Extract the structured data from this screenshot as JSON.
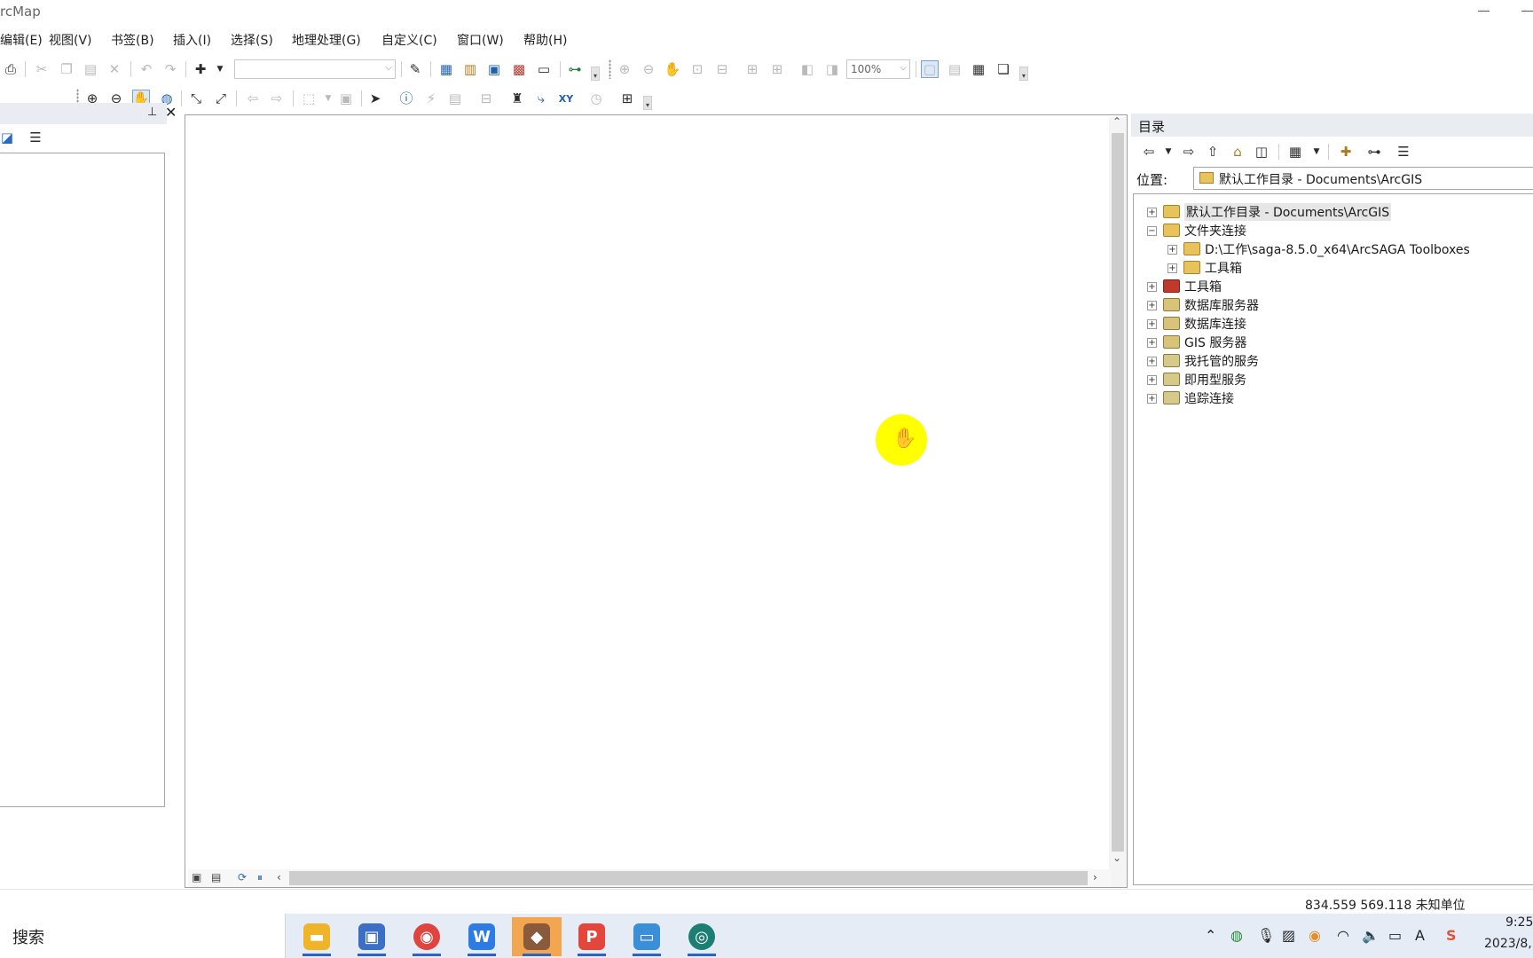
{
  "window": {
    "title": "rcMap"
  },
  "menu": [
    "编辑(E)",
    "视图(V)",
    "书签(B)",
    "插入(I)",
    "选择(S)",
    "地理处理(G)",
    "自定义(C)",
    "窗口(W)",
    "帮助(H)"
  ],
  "toolbar": {
    "zoom_value": "100%",
    "layer_combo_value": ""
  },
  "catalog": {
    "title": "目录",
    "location_label": "位置:",
    "location_value": "默认工作目录 - Documents\\ArcGIS",
    "tree": [
      {
        "label": "默认工作目录 - Documents\\ArcGIS",
        "expander": "+",
        "icon": "home-folder-icon",
        "color": "#e8c25a",
        "selected": true
      },
      {
        "label": "文件夹连接",
        "expander": "−",
        "icon": "folder-connection-icon",
        "color": "#e8c25a"
      },
      {
        "label": "D:\\工作\\saga-8.5.0_x64\\ArcSAGA Toolboxes",
        "expander": "+",
        "icon": "folder-icon",
        "color": "#e8c25a",
        "child": true
      },
      {
        "label": "工具箱",
        "expander": "+",
        "icon": "folder-icon",
        "color": "#e8c25a",
        "child": true
      },
      {
        "label": "工具箱",
        "expander": "+",
        "icon": "toolbox-icon",
        "color": "#c0392b"
      },
      {
        "label": "数据库服务器",
        "expander": "+",
        "icon": "database-server-icon",
        "color": "#d9c27a"
      },
      {
        "label": "数据库连接",
        "expander": "+",
        "icon": "database-connection-icon",
        "color": "#d9c27a"
      },
      {
        "label": "GIS 服务器",
        "expander": "+",
        "icon": "gis-server-icon",
        "color": "#d9c27a"
      },
      {
        "label": "我托管的服务",
        "expander": "+",
        "icon": "hosted-services-icon",
        "color": "#d6c98a"
      },
      {
        "label": "即用型服务",
        "expander": "+",
        "icon": "ready-services-icon",
        "color": "#d6c98a"
      },
      {
        "label": "追踪连接",
        "expander": "+",
        "icon": "tracking-connection-icon",
        "color": "#d6c98a"
      }
    ]
  },
  "status": {
    "coordinates": "834.559  569.118 未知单位"
  },
  "taskbar": {
    "search_label": "搜索",
    "apps": [
      {
        "name": "file-explorer-icon",
        "color": "#f0b429",
        "glyph": "▬"
      },
      {
        "name": "remote-desktop-icon",
        "color": "#3b6fc4",
        "glyph": "▣"
      },
      {
        "name": "chrome-icon",
        "color": "#e0443e",
        "glyph": "◉"
      },
      {
        "name": "wps-writer-icon",
        "color": "#2d7be5",
        "glyph": "W"
      },
      {
        "name": "arcmap-icon",
        "color": "#8a5a3c",
        "glyph": "◆"
      },
      {
        "name": "wps-presentation-icon",
        "color": "#e5463c",
        "glyph": "P"
      },
      {
        "name": "screen-tool-icon",
        "color": "#3a8fd6",
        "glyph": "▭"
      },
      {
        "name": "search-tool-icon",
        "color": "#1d7f73",
        "glyph": "◎"
      }
    ],
    "time": "9:25",
    "date": "2023/8,"
  }
}
